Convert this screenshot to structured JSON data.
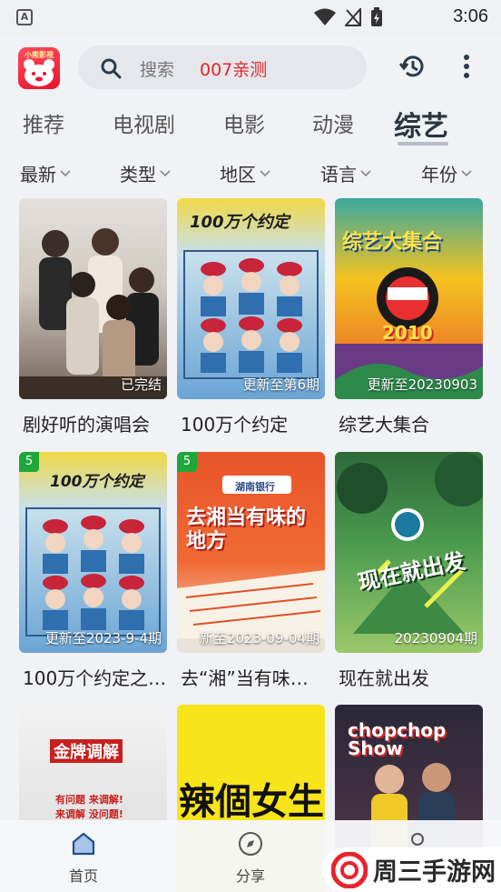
{
  "status": {
    "time": "3:06",
    "notification_icon": "A"
  },
  "header": {
    "logo_text": "小熊影视",
    "search_placeholder": "搜索",
    "search_promo": "007亲测"
  },
  "tabs": [
    {
      "label": "推荐"
    },
    {
      "label": "电视剧"
    },
    {
      "label": "电影"
    },
    {
      "label": "动漫"
    },
    {
      "label": "综艺",
      "active": true
    }
  ],
  "filters": [
    {
      "label": "最新"
    },
    {
      "label": "类型"
    },
    {
      "label": "地区"
    },
    {
      "label": "语言"
    },
    {
      "label": "年份"
    }
  ],
  "cards": [
    {
      "title": "剧好听的演唱会",
      "badge": "已完结"
    },
    {
      "title": "100万个约定",
      "badge": "更新至第6期",
      "poster_text": "100万个约定"
    },
    {
      "title": "综艺大集合",
      "badge": "更新至20230903",
      "poster_text": "综艺大集合",
      "poster_year": "2010"
    },
    {
      "title": "100万个约定之…",
      "badge": "更新至2023-9-4期",
      "num": "5",
      "poster_text": "100万个约定"
    },
    {
      "title": "去“湘”当有味…",
      "badge": "新至2023-09-04期",
      "num": "5",
      "poster_text": "去湘当有味的地方",
      "poster_bank": "湖南银行"
    },
    {
      "title": "现在就出发",
      "badge": "20230904期",
      "poster_text": "现在就出发"
    },
    {
      "title": "",
      "badge": "",
      "poster_text": "金牌调解",
      "poster_lines": [
        "有问题 来调解!",
        "来调解 没问题!"
      ]
    },
    {
      "title": "",
      "badge": "",
      "poster_text": "辣個女生"
    },
    {
      "title": "",
      "badge": "",
      "poster_text": "chopchop Show"
    }
  ],
  "bottom_nav": [
    {
      "label": "首页",
      "icon": "home-icon",
      "active": true
    },
    {
      "label": "分享",
      "icon": "compass-icon"
    },
    {
      "label": "",
      "icon": "profile-icon"
    }
  ],
  "watermark": {
    "text": "周三手游网"
  },
  "colors": {
    "accent_red": "#e8242c",
    "badge_green": "#1fa83a",
    "background": "#f1f2f5"
  }
}
